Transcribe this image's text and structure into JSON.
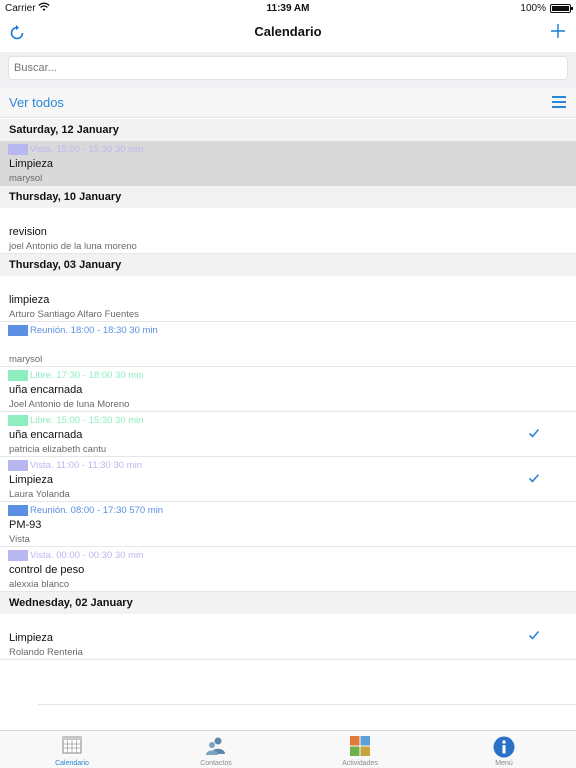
{
  "status_bar": {
    "carrier": "Carrier",
    "time": "11:39 AM",
    "battery": "100%"
  },
  "nav": {
    "title": "Calendario"
  },
  "search": {
    "placeholder": "Buscar..."
  },
  "filter": {
    "label": "Ver todos"
  },
  "sections": [
    {
      "header": "Saturday, 12 January",
      "items": [
        {
          "tag": "Vista. 15:00 - 15:30 30 min",
          "tag_color": "#b9b7f0",
          "title": "Limpieza",
          "sub": "marysol",
          "selected": true,
          "checked": false
        }
      ]
    },
    {
      "header": "Thursday, 10 January",
      "items": [
        {
          "tag": "",
          "tag_color": "",
          "title": "revision",
          "sub": "joel Antonio de la luna moreno",
          "selected": false,
          "checked": false
        }
      ]
    },
    {
      "header": "Thursday, 03 January",
      "items": [
        {
          "tag": "",
          "tag_color": "",
          "title": "limpieza",
          "sub": "Arturo Santiago Alfaro Fuentes",
          "selected": false,
          "checked": false
        },
        {
          "tag": "Reunión. 18:00 - 18:30 30 min",
          "tag_color": "#5b8fe4",
          "title": "",
          "sub": "marysol",
          "selected": false,
          "checked": false
        },
        {
          "tag": "Libre. 17:30 - 18:00 30 min",
          "tag_color": "#8eeec0",
          "title": "uña encarnada",
          "sub": "Joel Antonio de luna  Moreno",
          "selected": false,
          "checked": false
        },
        {
          "tag": "Libre. 15:00 - 15:30 30 min",
          "tag_color": "#8eeec0",
          "title": "uña encarnada",
          "sub": "patricia elizabeth cantu",
          "selected": false,
          "checked": true
        },
        {
          "tag": "Vista. 11:00 - 11:30 30 min",
          "tag_color": "#b9b7f0",
          "title": "Limpieza",
          "sub": "Laura Yolanda",
          "selected": false,
          "checked": true
        },
        {
          "tag": "Reunión. 08:00 - 17:30 570 min",
          "tag_color": "#5b8fe4",
          "title": "PM-93",
          "sub": "Vista",
          "selected": false,
          "checked": false
        },
        {
          "tag": "Vista. 00:00 - 00:30 30 min",
          "tag_color": "#b9b7f0",
          "title": "control de peso",
          "sub": "alexxia blanco",
          "selected": false,
          "checked": false
        }
      ]
    },
    {
      "header": "Wednesday, 02 January",
      "items": [
        {
          "tag": "",
          "tag_color": "",
          "title": "Limpieza",
          "sub": "Rolando Renteria",
          "selected": false,
          "checked": true
        }
      ]
    }
  ],
  "tabs": [
    {
      "label": "Calendario",
      "icon": "calendar-icon",
      "active": true
    },
    {
      "label": "Contactos",
      "icon": "contacts-icon",
      "active": false
    },
    {
      "label": "Actividades",
      "icon": "activities-icon",
      "active": false
    },
    {
      "label": "Menú",
      "icon": "info-icon",
      "active": false
    }
  ],
  "colors": {
    "accent": "#2a86d8",
    "selected_row": "#d9d9d9",
    "header_bg": "#f2f2f2"
  }
}
